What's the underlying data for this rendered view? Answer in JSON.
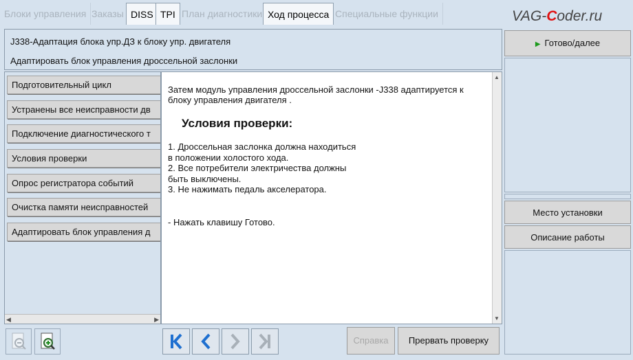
{
  "tabs": [
    {
      "label": "Блоки управления",
      "active": false
    },
    {
      "label": "Заказы",
      "active": false
    },
    {
      "label": "DISS",
      "active": true
    },
    {
      "label": "TPI",
      "active": true
    },
    {
      "label": "План диагностики",
      "active": false
    },
    {
      "label": "Ход процесса",
      "active": true
    },
    {
      "label": "Специальные функции",
      "active": false
    }
  ],
  "watermark": {
    "pre": "VAG-",
    "accent": "C",
    "post": "oder.ru"
  },
  "header": {
    "line1": "J338-Адаптация блока упр.ДЗ к блоку упр. двигателя",
    "line2": "Адаптировать блок управления дроссельной заслонки"
  },
  "right": {
    "next_label": "Готово/далее",
    "install_label": "Место установки",
    "work_desc_label": "Описание работы"
  },
  "steps": [
    "Подготовительный цикл",
    "Устранены все неисправности дв",
    "Подключение диагностического т",
    "Условия проверки",
    "Опрос регистратора событий",
    "Очистка памяти неисправностей",
    "Адаптировать блок управления д"
  ],
  "content": {
    "intro1": "Затем модуль управления дроссельной заслонки -J338 адаптируется к",
    "intro2": "блоку управления двигателя .",
    "heading": "Условия проверки:",
    "list": [
      "1. Дроссельная заслонка должна находиться",
      "в положении холостого хода.",
      "2. Все потребители электричества  должны",
      "быть выключены.",
      "3. Не нажимать педаль акселератора."
    ],
    "note": "- Нажать клавишу Готово."
  },
  "bottom": {
    "help_label": "Справка",
    "abort_label": "Прервать проверку"
  },
  "colors": {
    "accent": "#1e6fd0",
    "next_arrow": "#1c9a1c",
    "logo_accent": "#e01010"
  }
}
